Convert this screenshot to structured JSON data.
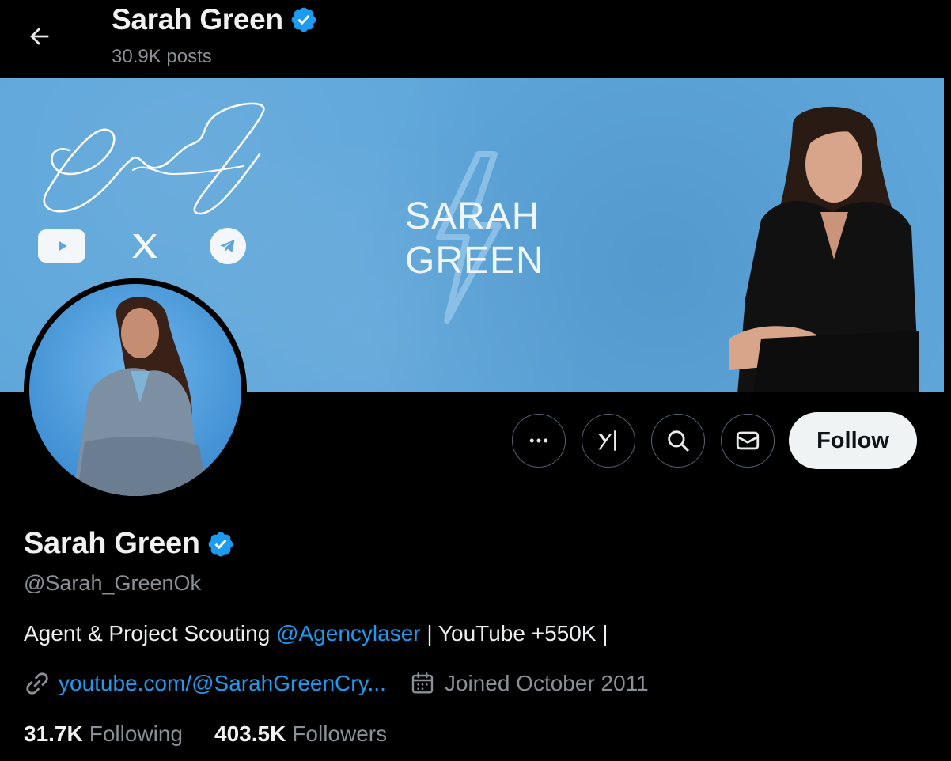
{
  "header": {
    "title": "Sarah Green",
    "posts_count": "30.9K posts"
  },
  "banner": {
    "brand_line1": "SARAH",
    "brand_line2": "GREEN",
    "signature_text": "SG",
    "social_icons": [
      "youtube-icon",
      "x-icon",
      "telegram-icon"
    ]
  },
  "profile": {
    "name": "Sarah Green",
    "handle": "@Sarah_GreenOk",
    "bio_prefix": "Agent & Project Scouting ",
    "bio_mention": "@Agencylaser",
    "bio_suffix": " | YouTube +550K |",
    "website": "youtube.com/@SarahGreenCry...",
    "joined": "Joined October 2011",
    "following_count": "31.7K",
    "following_label": "Following",
    "followers_count": "403.5K",
    "followers_label": "Followers"
  },
  "actions": {
    "follow_label": "Follow",
    "icons": [
      "more-icon",
      "grok-icon",
      "search-icon",
      "message-icon"
    ]
  },
  "colors": {
    "accent": "#1d9bf0",
    "banner": "#5ea6da",
    "follow_button": "#eff3f4",
    "verified": "#1d9bf0"
  }
}
